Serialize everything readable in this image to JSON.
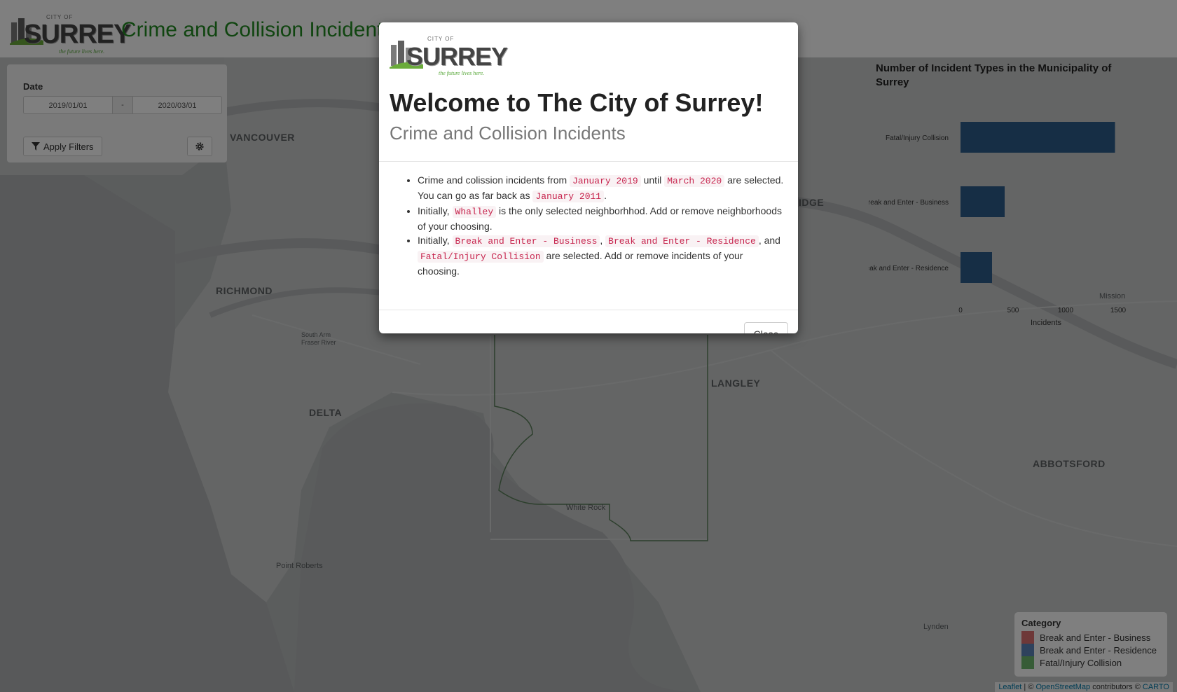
{
  "header": {
    "logo": {
      "city_of": "CITY OF",
      "name": "SURREY",
      "tagline": "the future lives here."
    },
    "title": "Crime and Collision Incidents"
  },
  "filters": {
    "date_label": "Date",
    "start_date": "2019/01/01",
    "separator": "-",
    "end_date": "2020/03/01",
    "apply_label": "Apply Filters",
    "apply_icon": "filter-icon",
    "settings_icon": "gear-icon"
  },
  "map": {
    "labels": [
      "VANCOUVER",
      "RICHMOND",
      "DELTA",
      "LANGLEY",
      "ABBOTSFORD",
      "IDGE",
      "Mission",
      "White Rock",
      "Point Roberts",
      "Lynden",
      "South Arm Fraser River"
    ],
    "attribution": {
      "leaflet": "Leaflet",
      "separator": " | © ",
      "osm": "OpenStreetMap",
      "contributors": " contributors © ",
      "carto": "CARTO"
    }
  },
  "chart_data": {
    "type": "bar",
    "orientation": "horizontal",
    "title": "Number of Incident Types in the Municipality of Surrey",
    "categories": [
      "Fatal/Injury Collision",
      "Break and Enter - Business",
      "Break and Enter - Residence"
    ],
    "values": [
      1470,
      420,
      300
    ],
    "xlabel": "Incidents",
    "ylabel": "",
    "xlim": [
      0,
      1600
    ],
    "xticks": [
      0,
      500,
      1000,
      1500
    ],
    "bar_color": "#2c5c8a",
    "grid": false
  },
  "legend": {
    "title": "Category",
    "items": [
      {
        "label": "Break and Enter - Business",
        "color": "#d86060"
      },
      {
        "label": "Break and Enter - Residence",
        "color": "#4a78b4"
      },
      {
        "label": "Fatal/Injury Collision",
        "color": "#5fb05f"
      }
    ]
  },
  "modal": {
    "logo": {
      "city_of": "CITY OF",
      "name": "SURREY",
      "tagline": "the future lives here."
    },
    "title": "Welcome to The City of Surrey!",
    "subtitle": "Crime and Collision Incidents",
    "bullets": [
      {
        "t1": "Crime and colission incidents from ",
        "c1": "January 2019",
        "t2": " until ",
        "c2": "March 2020",
        "t3": " are selected. You can go as far back as ",
        "c3": "January 2011",
        "t4": "."
      },
      {
        "t1": "Initially, ",
        "c1": "Whalley",
        "t2": " is the only selected neighborhhod. Add or remove neighborhoods of your choosing."
      },
      {
        "t1": "Initially, ",
        "c1": "Break and Enter - Business",
        "t2": ", ",
        "c2": "Break and Enter - Residence",
        "t3": ", and ",
        "c3": "Fatal/Injury Collision",
        "t4": " are selected. Add or remove incidents of your choosing."
      }
    ],
    "close_label": "Close"
  }
}
